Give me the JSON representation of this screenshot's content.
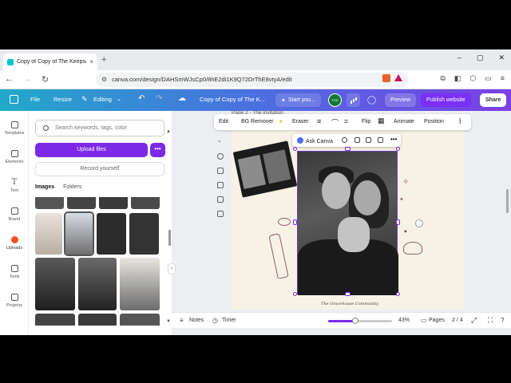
{
  "browser": {
    "tab_title": "Copy of Copy of The Keepsake:",
    "tab_close": "×",
    "new_tab": "+",
    "url": "canva.com/design/DAHSmWJsCp0/8hE2di1K9Q72DrThE8vtyA/edit",
    "window_minimize": "–",
    "window_restore": "▢",
    "window_close": "✕"
  },
  "header": {
    "file": "File",
    "resize": "Resize",
    "editing": "Editing",
    "doc_title": "Copy of Copy of The K...",
    "start_button": "Start you...",
    "avatar_text": "TGD",
    "preview": "Preview",
    "publish": "Publish website",
    "share": "Share"
  },
  "rail": {
    "items": [
      "Templates",
      "Elements",
      "Text",
      "Brand",
      "Uploads",
      "Tools",
      "Projects"
    ],
    "active": "Uploads"
  },
  "panel": {
    "search_placeholder": "Search keywords, tags, color",
    "upload_button": "Upload files",
    "more_button": "•••",
    "record_button": "Record yourself",
    "tabs": [
      "Images",
      "Folders"
    ],
    "active_tab": "Images"
  },
  "toolbar": {
    "edit": "Edit",
    "bg_remover": "BG Remover",
    "eraser": "Eraser",
    "flip": "Flip",
    "animate": "Animate",
    "position": "Position"
  },
  "canvas": {
    "page_label": "Page 2 - The invitation",
    "ask_canva": "Ask Canva",
    "signature": "The Gracehouse Community"
  },
  "bottom": {
    "notes": "Notes",
    "timer": "Timer",
    "zoom_percent": "43%",
    "zoom_fraction": 0.43,
    "pages_label": "Pages",
    "pages_count": "2 / 4"
  },
  "colors": {
    "accent": "#7d2ae8",
    "uploads_icon": "#f4511e"
  }
}
